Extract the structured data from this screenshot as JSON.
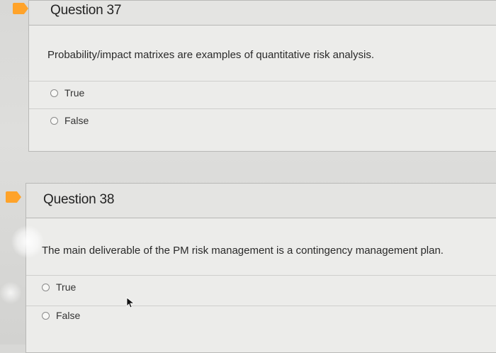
{
  "questions": [
    {
      "title": "Question 37",
      "text": "Probability/impact matrixes are examples of quantitative risk analysis.",
      "options": [
        "True",
        "False"
      ]
    },
    {
      "title": "Question 38",
      "text": "The main deliverable of the PM risk management is a contingency management plan.",
      "options": [
        "True",
        "False"
      ]
    }
  ],
  "colors": {
    "marker": "#ffa32a",
    "card_background": "#ececea",
    "page_background": "#dcdcda"
  }
}
